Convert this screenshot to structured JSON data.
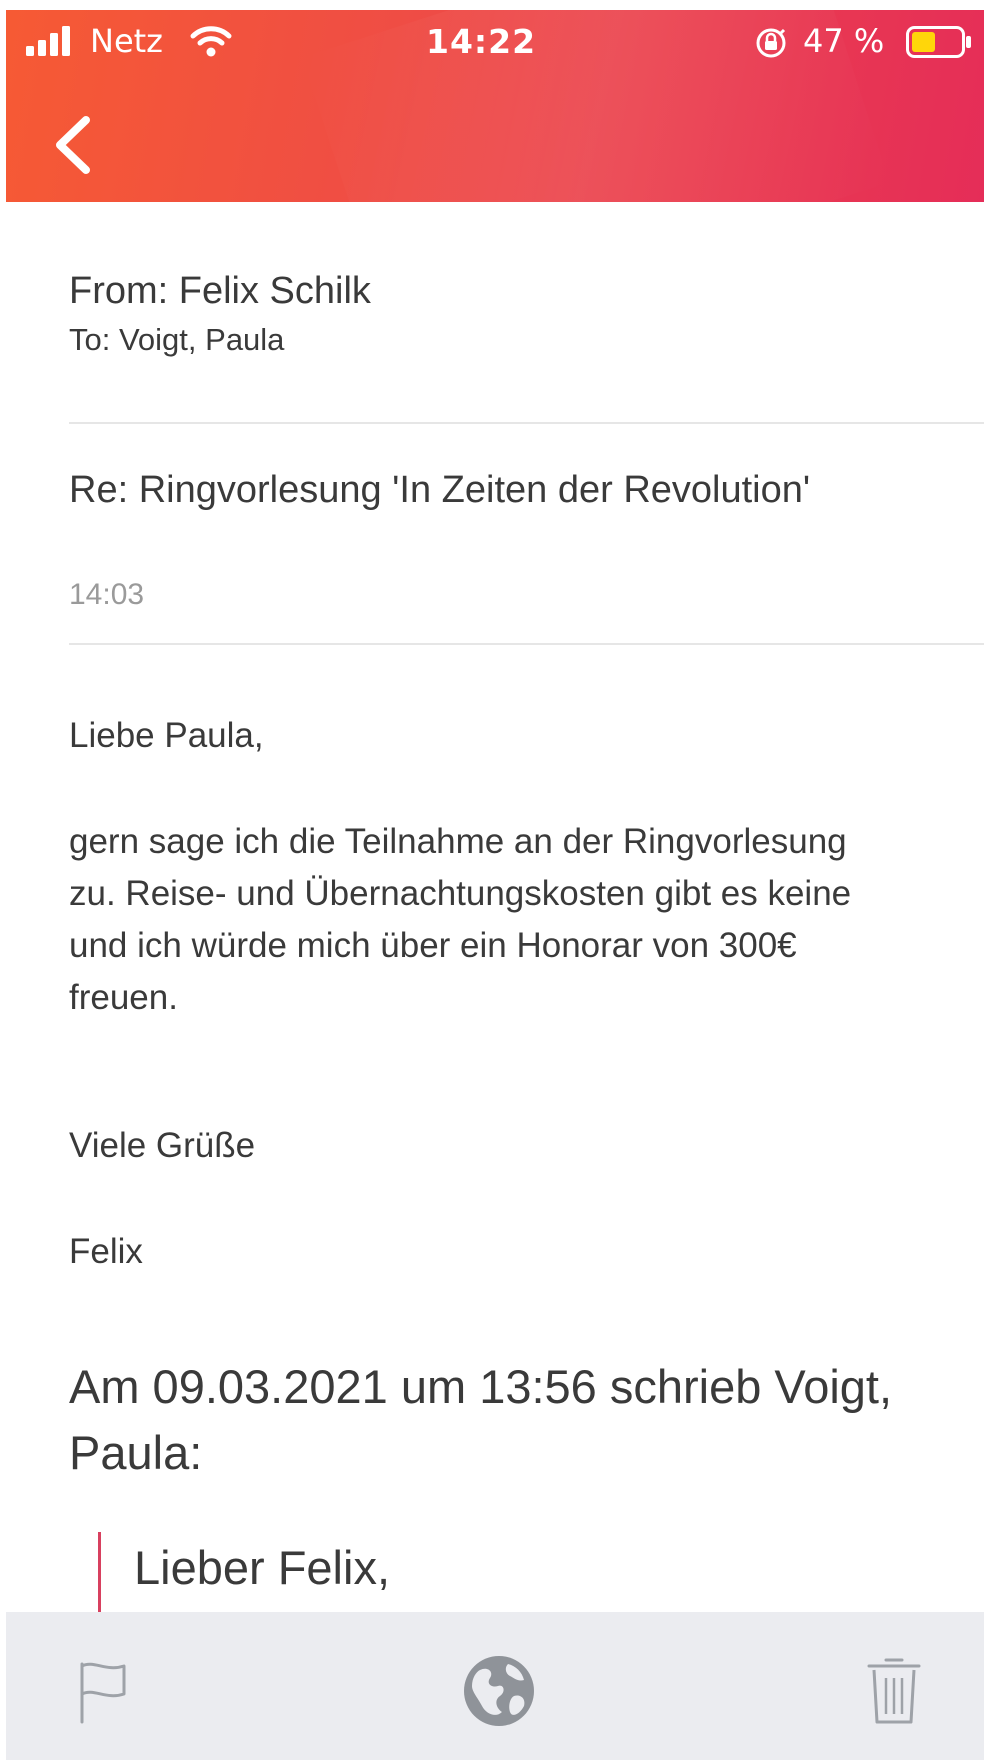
{
  "status_bar": {
    "carrier": "Netz",
    "time": "14:22",
    "battery_percent": "47 %",
    "icons": [
      "signal-icon",
      "wifi-icon",
      "orientation-lock-icon",
      "battery-icon"
    ]
  },
  "header": {
    "back_icon": "chevron-left-icon",
    "gradient_colors": [
      "#f65a34",
      "#e52d58"
    ]
  },
  "email": {
    "from": "From: Felix Schilk",
    "to": "To: Voigt, Paula",
    "subject": "Re: Ringvorlesung 'In Zeiten der Revolution'",
    "time": "14:03",
    "greeting": "Liebe Paula,",
    "body": "gern sage ich die Teilnahme an der Ringvorlesung zu. Reise- und Übernachtungskosten gibt es keine und ich würde mich über ein Honorar von 300€ freuen.",
    "closing": "Viele Grüße",
    "signature": "Felix",
    "quote_header": "Am 09.03.2021 um 13:56 schrieb Voigt, Paula:",
    "quote_first_line": "Lieber Felix,"
  },
  "toolbar": {
    "items": [
      "flag-icon",
      "globe-icon",
      "trash-icon"
    ]
  },
  "colors": {
    "accent": "#e52d58",
    "quote_bar": "#d8405f",
    "toolbar_bg": "#ebecf0"
  }
}
